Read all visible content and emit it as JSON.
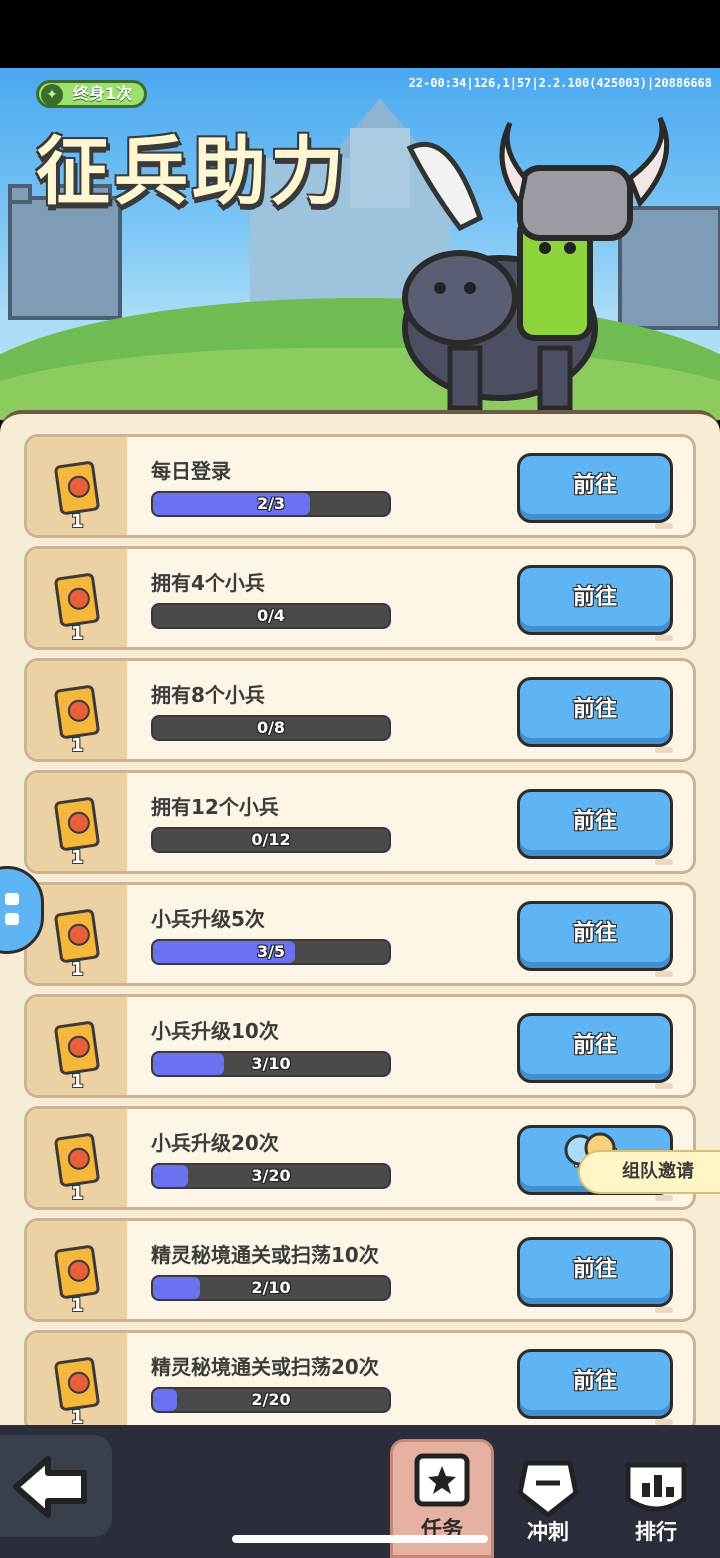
{
  "banner": {
    "badge_label": "终身1次",
    "version_text": "22-00:34|126,1|57|2.2.100(425003)|20886668",
    "title": "征兵助力"
  },
  "tasks": [
    {
      "title": "每日登录",
      "progress_text": "2/3",
      "progress": 0.667,
      "reward_count": "1",
      "button_label": "前往"
    },
    {
      "title": "拥有4个小兵",
      "progress_text": "0/4",
      "progress": 0,
      "reward_count": "1",
      "button_label": "前往"
    },
    {
      "title": "拥有8个小兵",
      "progress_text": "0/8",
      "progress": 0,
      "reward_count": "1",
      "button_label": "前往"
    },
    {
      "title": "拥有12个小兵",
      "progress_text": "0/12",
      "progress": 0,
      "reward_count": "1",
      "button_label": "前往"
    },
    {
      "title": "小兵升级5次",
      "progress_text": "3/5",
      "progress": 0.6,
      "reward_count": "1",
      "button_label": "前往"
    },
    {
      "title": "小兵升级10次",
      "progress_text": "3/10",
      "progress": 0.3,
      "reward_count": "1",
      "button_label": "前往"
    },
    {
      "title": "小兵升级20次",
      "progress_text": "3/20",
      "progress": 0.15,
      "reward_count": "1",
      "button_label": "前往"
    },
    {
      "title": "精灵秘境通关或扫荡10次",
      "progress_text": "2/10",
      "progress": 0.2,
      "reward_count": "1",
      "button_label": "前往"
    },
    {
      "title": "精灵秘境通关或扫荡20次",
      "progress_text": "2/20",
      "progress": 0.1,
      "reward_count": "1",
      "button_label": "前往"
    }
  ],
  "team_invite_label": "组队邀请",
  "bottom_nav": {
    "tabs": [
      {
        "label": "任务",
        "icon": "task-scroll-icon",
        "active": true
      },
      {
        "label": "冲刺",
        "icon": "sprint-icon",
        "active": false
      },
      {
        "label": "排行",
        "icon": "ranking-icon",
        "active": false
      }
    ]
  },
  "colors": {
    "go_button": "#5fb4f4",
    "progress_fill": "#6a72f2",
    "panel_bg": "#f7ecd5"
  }
}
